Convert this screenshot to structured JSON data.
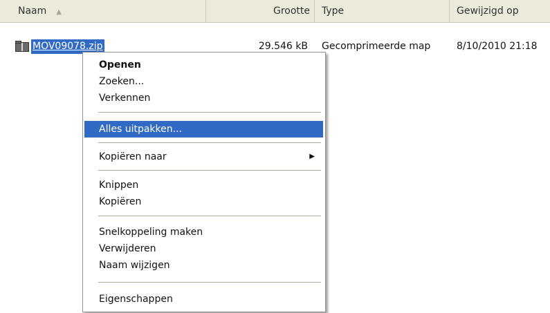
{
  "columns": {
    "name": "Naam",
    "size": "Grootte",
    "type": "Type",
    "modified": "Gewijzigd op"
  },
  "icons": {
    "sort": "sort-ascending-icon",
    "file": "zip-folder-icon",
    "submenu": "submenu-arrow-icon"
  },
  "file": {
    "name": "MOV09078.zip",
    "size": "29.546 kB",
    "type": "Gecomprimeerde map",
    "modified": "8/10/2010 21:18"
  },
  "menu": {
    "open": "Openen",
    "search": "Zoeken...",
    "explore": "Verkennen",
    "extract_all": "Alles uitpakken...",
    "copy_to": "Kopiëren naar",
    "cut": "Knippen",
    "copy": "Kopiëren",
    "create_shortcut": "Snelkoppeling maken",
    "delete": "Verwijderen",
    "rename": "Naam wijzigen",
    "properties": "Eigenschappen"
  },
  "colors": {
    "highlight": "#316ac5",
    "header_bg": "#ebeadb"
  }
}
